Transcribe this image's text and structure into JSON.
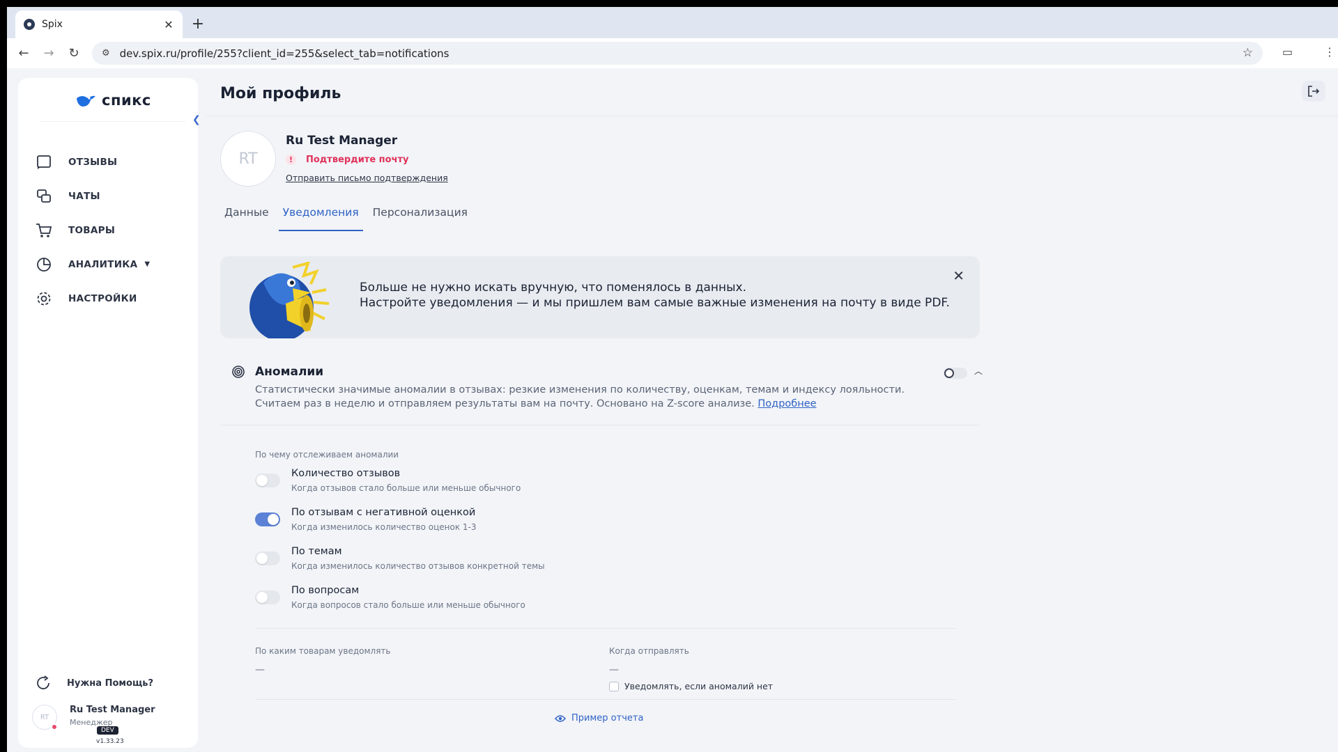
{
  "browser": {
    "tab_title": "Spix",
    "url": "dev.spix.ru/profile/255?client_id=255&select_tab=notifications"
  },
  "sidebar": {
    "logo_text": "спикс",
    "items": [
      {
        "label": "ОТЗЫВЫ",
        "icon": "message-square-icon"
      },
      {
        "label": "ЧАТЫ",
        "icon": "chats-icon"
      },
      {
        "label": "ТОВАРЫ",
        "icon": "cart-icon"
      },
      {
        "label": "АНАЛИТИКА",
        "icon": "pie-chart-icon"
      },
      {
        "label": "НАСТРОЙКИ",
        "icon": "gear-icon"
      }
    ],
    "help_label": "Нужна Помощь?",
    "user": {
      "avatar": "RT",
      "name": "Ru Test Manager",
      "role": "Менеджер"
    },
    "env_badge": "DEV",
    "version": "v1.33.23"
  },
  "page": {
    "title": "Мой профиль",
    "profile": {
      "avatar": "RT",
      "name": "Ru Test Manager",
      "confirm_text": "Подтвердите почту",
      "resend_link": "Отправить письмо подтверждения"
    },
    "tabs": [
      {
        "label": "Данные",
        "active": false
      },
      {
        "label": "Уведомления",
        "active": true
      },
      {
        "label": "Персонализация",
        "active": false
      }
    ],
    "banner": {
      "line1": "Больше не нужно искать вручную, что поменялось в данных.",
      "line2": "Настройте уведомления — и мы пришлем вам самые важные изменения на почту в виде PDF."
    },
    "anomalies": {
      "title": "Аномалии",
      "enabled": false,
      "description": "Статистически значимые аномалии в отзывах: резкие изменения по количеству, оценкам, темам и индексу лояльности. Считаем раз в неделю и отправляем результаты вам на почту. Основано на Z-score анализе.",
      "more_link": "Подробнее",
      "track_label": "По чему отслеживаем аномалии",
      "options": [
        {
          "title": "Количество отзывов",
          "subtitle": "Когда отзывов стало больше или меньше обычного",
          "on": false
        },
        {
          "title": "По отзывам с негативной оценкой",
          "subtitle": "Когда изменилось количество оценок 1-3",
          "on": true
        },
        {
          "title": "По темам",
          "subtitle": "Когда изменилось количество отзывов конкретной темы",
          "on": false
        },
        {
          "title": "По вопросам",
          "subtitle": "Когда вопросов стало больше или меньше обычного",
          "on": false
        }
      ],
      "products_label": "По каким товарам уведомлять",
      "products_value": "—",
      "when_label": "Когда отправлять",
      "when_value": "—",
      "notify_if_none": "Уведомлять, если аномалий нет",
      "notify_if_none_checked": false,
      "example_link": "Пример отчета"
    }
  },
  "colors": {
    "accent": "#2f62c4",
    "danger": "#e0325a",
    "toggle_on": "#5b82d6"
  }
}
